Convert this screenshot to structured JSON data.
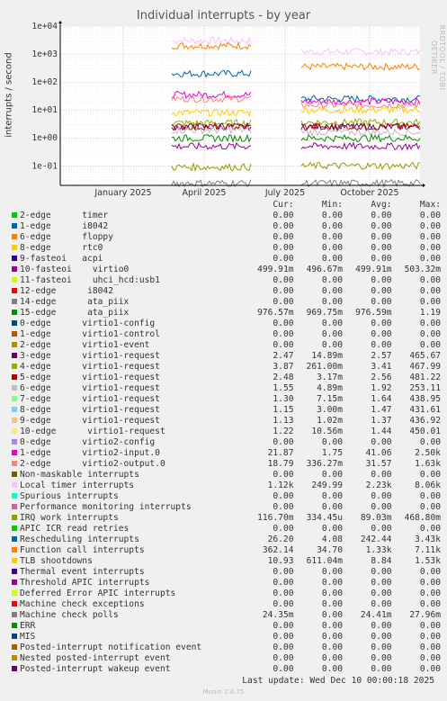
{
  "chart_data": {
    "type": "line",
    "title": "Individual interrupts - by year",
    "ylabel": "interrupts / second",
    "y_scale": "log",
    "ylim": [
      0.02,
      10000
    ],
    "y_ticks": [
      "1e-01",
      "1e+00",
      "1e+01",
      "1e+02",
      "1e+03",
      "1e+04"
    ],
    "y_tick_values": [
      0.1,
      1,
      10,
      100,
      1000,
      10000
    ],
    "x_ticks": [
      "January 2025",
      "April 2025",
      "July 2025",
      "October 2025"
    ],
    "grid": true,
    "legend_placement": "bottom",
    "columns": [
      "Cur:",
      "Min:",
      "Avg:",
      "Max:"
    ],
    "series": [
      {
        "name": "2-edge      timer",
        "color": "#00cc00",
        "cur": "0.00",
        "min": "0.00",
        "avg": "0.00",
        "max": "0.00"
      },
      {
        "name": "1-edge      i8042",
        "color": "#0066b3",
        "cur": "0.00",
        "min": "0.00",
        "avg": "0.00",
        "max": "0.00"
      },
      {
        "name": "6-edge      floppy",
        "color": "#ff8000",
        "cur": "0.00",
        "min": "0.00",
        "avg": "0.00",
        "max": "0.00"
      },
      {
        "name": "8-edge      rtc0",
        "color": "#ffcc00",
        "cur": "0.00",
        "min": "0.00",
        "avg": "0.00",
        "max": "0.00"
      },
      {
        "name": "9-fasteoi   acpi",
        "color": "#330099",
        "cur": "0.00",
        "min": "0.00",
        "avg": "0.00",
        "max": "0.00"
      },
      {
        "name": "10-fasteoi    virtio0",
        "color": "#990099",
        "cur": "499.91m",
        "min": "496.67m",
        "avg": "499.91m",
        "max": "503.32m"
      },
      {
        "name": "11-fasteoi    uhci_hcd:usb1",
        "color": "#ccff00",
        "cur": "0.00",
        "min": "0.00",
        "avg": "0.00",
        "max": "0.00"
      },
      {
        "name": "12-edge      i8042",
        "color": "#ff0000",
        "cur": "0.00",
        "min": "0.00",
        "avg": "0.00",
        "max": "0.00"
      },
      {
        "name": "14-edge      ata_piix",
        "color": "#808080",
        "cur": "0.00",
        "min": "0.00",
        "avg": "0.00",
        "max": "0.00"
      },
      {
        "name": "15-edge      ata_piix",
        "color": "#008f00",
        "cur": "976.57m",
        "min": "969.75m",
        "avg": "976.59m",
        "max": "1.19"
      },
      {
        "name": "0-edge      virtio1-config",
        "color": "#00487d",
        "cur": "0.00",
        "min": "0.00",
        "avg": "0.00",
        "max": "0.00"
      },
      {
        "name": "1-edge      virtio1-control",
        "color": "#b35a00",
        "cur": "0.00",
        "min": "0.00",
        "avg": "0.00",
        "max": "0.00"
      },
      {
        "name": "2-edge      virtio1-event",
        "color": "#b38f00",
        "cur": "0.00",
        "min": "0.00",
        "avg": "0.00",
        "max": "0.00"
      },
      {
        "name": "3-edge      virtio1-request",
        "color": "#6b006b",
        "cur": "2.47",
        "min": "14.89m",
        "avg": "2.57",
        "max": "465.67"
      },
      {
        "name": "4-edge      virtio1-request",
        "color": "#8fb300",
        "cur": "3.87",
        "min": "261.00m",
        "avg": "3.41",
        "max": "467.99"
      },
      {
        "name": "5-edge      virtio1-request",
        "color": "#b30000",
        "cur": "2.48",
        "min": "3.17m",
        "avg": "2.56",
        "max": "481.22"
      },
      {
        "name": "6-edge      virtio1-request",
        "color": "#bebebe",
        "cur": "1.55",
        "min": "4.89m",
        "avg": "1.92",
        "max": "253.11"
      },
      {
        "name": "7-edge      virtio1-request",
        "color": "#80ff80",
        "cur": "1.30",
        "min": "7.15m",
        "avg": "1.64",
        "max": "438.95"
      },
      {
        "name": "8-edge      virtio1-request",
        "color": "#80c9ff",
        "cur": "1.15",
        "min": "3.00m",
        "avg": "1.47",
        "max": "431.61"
      },
      {
        "name": "9-edge      virtio1-request",
        "color": "#ffc080",
        "cur": "1.13",
        "min": "1.02m",
        "avg": "1.37",
        "max": "436.92"
      },
      {
        "name": "10-edge      virtio1-request",
        "color": "#ffe680",
        "cur": "1.22",
        "min": "10.56m",
        "avg": "1.44",
        "max": "450.01"
      },
      {
        "name": "0-edge      virtio2-config",
        "color": "#aa80ff",
        "cur": "0.00",
        "min": "0.00",
        "avg": "0.00",
        "max": "0.00"
      },
      {
        "name": "1-edge      virtio2-input.0",
        "color": "#ee00cc",
        "cur": "21.87",
        "min": "1.75",
        "avg": "41.06",
        "max": "2.50k"
      },
      {
        "name": "2-edge      virtio2-output.0",
        "color": "#ff8080",
        "cur": "18.79",
        "min": "336.27m",
        "avg": "31.57",
        "max": "1.63k"
      },
      {
        "name": "Non-maskable interrupts",
        "color": "#666600",
        "cur": "0.00",
        "min": "0.00",
        "avg": "0.00",
        "max": "0.00"
      },
      {
        "name": "Local timer interrupts",
        "color": "#ffbfff",
        "cur": "1.12k",
        "min": "249.99",
        "avg": "2.23k",
        "max": "8.06k"
      },
      {
        "name": "Spurious interrupts",
        "color": "#00ffcc",
        "cur": "0.00",
        "min": "0.00",
        "avg": "0.00",
        "max": "0.00"
      },
      {
        "name": "Performance monitoring interrupts",
        "color": "#cc6699",
        "cur": "0.00",
        "min": "0.00",
        "avg": "0.00",
        "max": "0.00"
      },
      {
        "name": "IRQ work interrupts",
        "color": "#999900",
        "cur": "116.70m",
        "min": "334.45u",
        "avg": "89.03m",
        "max": "468.80m"
      },
      {
        "name": "APIC ICR read retries",
        "color": "#00cc00",
        "cur": "0.00",
        "min": "0.00",
        "avg": "0.00",
        "max": "0.00"
      },
      {
        "name": "Rescheduling interrupts",
        "color": "#0066b3",
        "cur": "26.20",
        "min": "4.08",
        "avg": "242.44",
        "max": "3.43k"
      },
      {
        "name": "Function call interrupts",
        "color": "#ff8000",
        "cur": "362.14",
        "min": "34.70",
        "avg": "1.33k",
        "max": "7.11k"
      },
      {
        "name": "TLB shootdowns",
        "color": "#ffcc00",
        "cur": "10.93",
        "min": "611.04m",
        "avg": "8.84",
        "max": "1.53k"
      },
      {
        "name": "Thermal event interrupts",
        "color": "#330099",
        "cur": "0.00",
        "min": "0.00",
        "avg": "0.00",
        "max": "0.00"
      },
      {
        "name": "Threshold APIC interrupts",
        "color": "#990099",
        "cur": "0.00",
        "min": "0.00",
        "avg": "0.00",
        "max": "0.00"
      },
      {
        "name": "Deferred Error APIC interrupts",
        "color": "#ccff00",
        "cur": "0.00",
        "min": "0.00",
        "avg": "0.00",
        "max": "0.00"
      },
      {
        "name": "Machine check exceptions",
        "color": "#ff0000",
        "cur": "0.00",
        "min": "0.00",
        "avg": "0.00",
        "max": "0.00"
      },
      {
        "name": "Machine check polls",
        "color": "#808080",
        "cur": "24.35m",
        "min": "0.00",
        "avg": "24.41m",
        "max": "27.96m"
      },
      {
        "name": "ERR",
        "color": "#008f00",
        "cur": "0.00",
        "min": "0.00",
        "avg": "0.00",
        "max": "0.00"
      },
      {
        "name": "MIS",
        "color": "#00487d",
        "cur": "0.00",
        "min": "0.00",
        "avg": "0.00",
        "max": "0.00"
      },
      {
        "name": "Posted-interrupt notification event",
        "color": "#b35a00",
        "cur": "0.00",
        "min": "0.00",
        "avg": "0.00",
        "max": "0.00"
      },
      {
        "name": "Nested posted-interrupt event",
        "color": "#b38f00",
        "cur": "0.00",
        "min": "0.00",
        "avg": "0.00",
        "max": "0.00"
      },
      {
        "name": "Posted-interrupt wakeup event",
        "color": "#6b006b",
        "cur": "0.00",
        "min": "0.00",
        "avg": "0.00",
        "max": "0.00"
      }
    ],
    "segments": [
      [
        "April 2025",
        "May 2025"
      ],
      [
        "August 2025",
        "December 2025"
      ]
    ],
    "plotted": [
      {
        "label": "Local timer interrupts",
        "color": "#ffbfff",
        "level_a": 3000,
        "level_b": 1200
      },
      {
        "label": "Function call interrupts",
        "color": "#ff8000",
        "level_a": 2000,
        "level_b": 350
      },
      {
        "label": "Rescheduling interrupts",
        "color": "#0066b3",
        "level_a": 200,
        "level_b": 25
      },
      {
        "label": "1-edge virtio2-input.0",
        "color": "#ee00cc",
        "level_a": 35,
        "level_b": 20
      },
      {
        "label": "2-edge virtio2-output.0",
        "color": "#ff8080",
        "level_a": 25,
        "level_b": 15
      },
      {
        "label": "TLB shootdowns",
        "color": "#ffcc00",
        "level_a": 8,
        "level_b": 10
      },
      {
        "label": "4-edge virtio1-request",
        "color": "#8fb300",
        "level_a": 3.4,
        "level_b": 3.6
      },
      {
        "label": "3-edge virtio1-request",
        "color": "#6b006b",
        "level_a": 2.5,
        "level_b": 2.5
      },
      {
        "label": "5-edge virtio1-request",
        "color": "#b30000",
        "level_a": 2.5,
        "level_b": 2.5
      },
      {
        "label": "6-edge virtio1-request",
        "color": "#bebebe",
        "level_a": 1.9,
        "level_b": 1.6
      },
      {
        "label": "15-edge ata_piix",
        "color": "#008f00",
        "level_a": 0.98,
        "level_b": 0.98
      },
      {
        "label": "10-fasteoi virtio0",
        "color": "#990099",
        "level_a": 0.5,
        "level_b": 0.5
      },
      {
        "label": "IRQ work interrupts",
        "color": "#999900",
        "level_a": 0.09,
        "level_b": 0.1
      },
      {
        "label": "Machine check polls",
        "color": "#808080",
        "level_a": 0.024,
        "level_b": 0.024
      }
    ]
  },
  "side_label": "RRDTOOL / TOBI OETIKER",
  "last_update": "Last update:  Wed Dec 10 00:00:18 2025",
  "version": "Munin 2.0.75"
}
